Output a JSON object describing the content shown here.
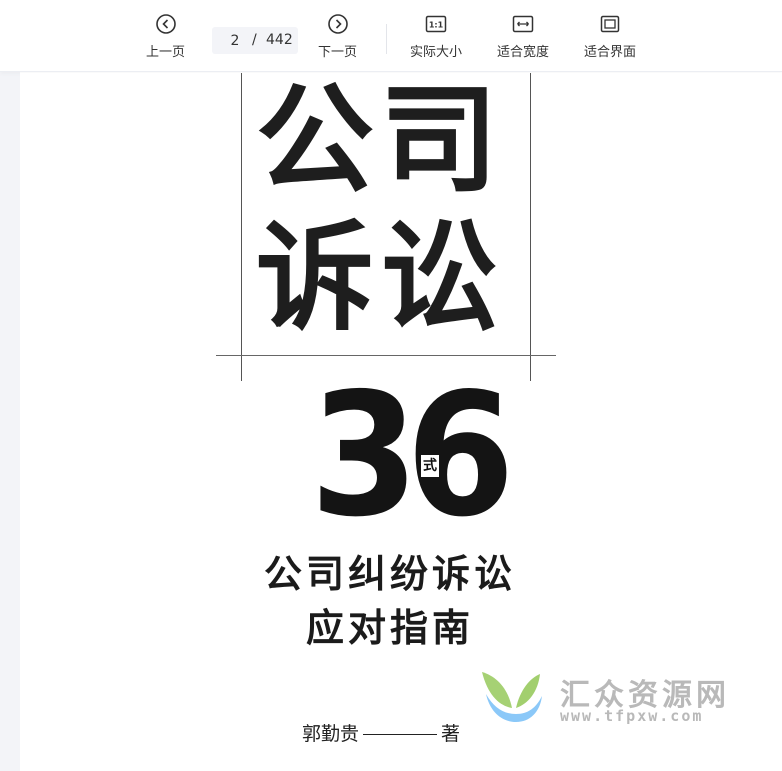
{
  "toolbar": {
    "prev_label": "上一页",
    "next_label": "下一页",
    "current_page": "2",
    "separator": "/",
    "total_pages": "442",
    "actual_size_label": "实际大小",
    "fit_width_label": "适合宽度",
    "fit_page_label": "适合界面",
    "actual_size_icon_text": "1:1",
    "icons": [
      "prev-circle-icon",
      "next-circle-icon",
      "actual-size-icon",
      "fit-width-icon",
      "fit-page-icon"
    ]
  },
  "book": {
    "title_line1": "公司",
    "title_line2": "诉讼",
    "number": "36",
    "number_suffix": "式",
    "subtitle_line1": "公司纠纷诉讼",
    "subtitle_line2": "应对指南",
    "author": "郭勤贵",
    "author_role": "著"
  },
  "watermark": {
    "name": "汇众资源网",
    "url": "www.tfpxw.com"
  },
  "colors": {
    "toolbar_text": "#333333",
    "gutter": "#f3f4f8",
    "print_black": "#1e1e1e",
    "watermark_gray": "#b9b9b9",
    "watermark_green": "#9ccc65",
    "watermark_blue": "#64b5f6"
  }
}
